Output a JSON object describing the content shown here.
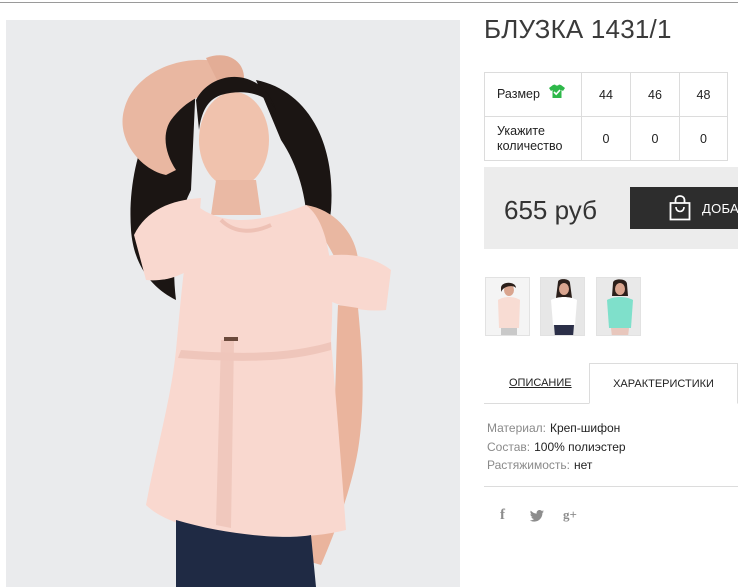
{
  "product": {
    "title": "БЛУЗКА 1431/1"
  },
  "size_table": {
    "size_label": "Размер",
    "sizes": [
      "44",
      "46",
      "48"
    ],
    "qty_label": "Укажите количество",
    "quantities": [
      "0",
      "0",
      "0"
    ]
  },
  "purchase": {
    "price": "655 руб",
    "cart_label": "ДОБАВ"
  },
  "tabs": {
    "description": "ОПИСАНИЕ",
    "characteristics": "ХАРАКТЕРИСТИКИ"
  },
  "specs": [
    {
      "label": "Материал:",
      "value": "Креп-шифон"
    },
    {
      "label": "Состав:",
      "value": "100% полиэстер"
    },
    {
      "label": "Растяжимость:",
      "value": "нет"
    }
  ],
  "social": {
    "facebook": "f",
    "google_plus": "g+"
  },
  "icons": [
    "shirt-size-icon",
    "shopping-bag-icon",
    "facebook-icon",
    "twitter-icon",
    "google-plus-icon"
  ],
  "colors": {
    "accent_dark": "#2d2d2d",
    "size_icon_green": "#2eb84a",
    "blouse_pink": "#f7d3c8",
    "thumb_mint": "#7fe0cb"
  }
}
